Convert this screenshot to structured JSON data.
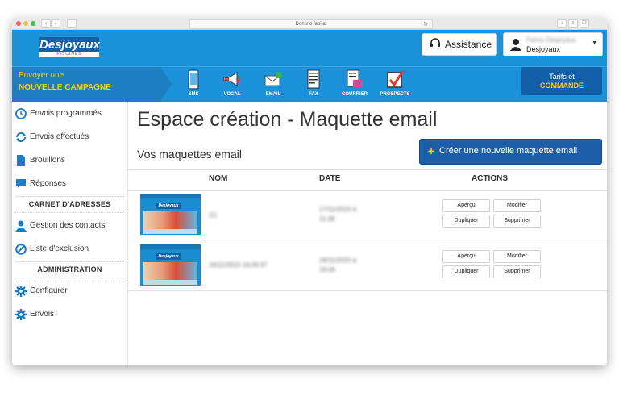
{
  "browser": {
    "url": "Domino fabitat"
  },
  "header": {
    "logo_text": "Desjoyaux",
    "logo_sub": "PISCINES",
    "assistance_label": "Assistance",
    "user_name": "Fanny Desjoyaux",
    "user_org": "Desjoyaux"
  },
  "campaign": {
    "line1": "Envoyer une",
    "line2": "NOUVELLE CAMPAGNE",
    "channels": [
      {
        "label": "SMS",
        "icon": "phone-icon"
      },
      {
        "label": "VOCAL",
        "icon": "megaphone-icon"
      },
      {
        "label": "EMAIL",
        "icon": "email-icon"
      },
      {
        "label": "FAX",
        "icon": "fax-icon"
      },
      {
        "label": "COURRIER",
        "icon": "letter-icon"
      },
      {
        "label": "PROSPECTS",
        "icon": "checkbox-icon"
      }
    ],
    "tarifs_l1": "Tarifs et",
    "tarifs_l2": "COMMANDE"
  },
  "sidebar": {
    "items": [
      {
        "label": "Envois programmés",
        "icon": "clock-icon"
      },
      {
        "label": "Envois effectués",
        "icon": "refresh-icon"
      },
      {
        "label": "Brouillons",
        "icon": "document-icon"
      },
      {
        "label": "Réponses",
        "icon": "chat-icon"
      }
    ],
    "section_address": "CARNET D'ADRESSES",
    "address_items": [
      {
        "label": "Gestion des contacts",
        "icon": "person-icon"
      },
      {
        "label": "Liste d'exclusion",
        "icon": "block-icon"
      }
    ],
    "section_admin": "ADMINISTRATION",
    "admin_items": [
      {
        "label": "Configurer",
        "icon": "gear-icon"
      },
      {
        "label": "Envois",
        "icon": "gear-icon"
      }
    ]
  },
  "main": {
    "title": "Espace création - Maquette email",
    "subtitle": "Vos maquettes email",
    "create_plus": "+",
    "create_label": "Créer une nouvelle maquette email",
    "columns": {
      "name": "NOM",
      "date": "DATE",
      "actions": "ACTIONS"
    },
    "rows": [
      {
        "thumb_brand": "Desjoyaux",
        "name": "(1)",
        "date_l1": "17/11/2015 à",
        "date_l2": "11:38"
      },
      {
        "thumb_brand": "Desjoyaux",
        "name": "16/11/2015 16:06:37",
        "date_l1": "16/11/2015 à",
        "date_l2": "16:06"
      }
    ],
    "actions": {
      "preview": "Aperçu",
      "edit": "Modifier",
      "duplicate": "Dupliquer",
      "delete": "Supprimer"
    }
  },
  "colors": {
    "brand_blue": "#1a91d9",
    "dark_blue": "#1460a8",
    "accent_yellow": "#f6d100"
  }
}
